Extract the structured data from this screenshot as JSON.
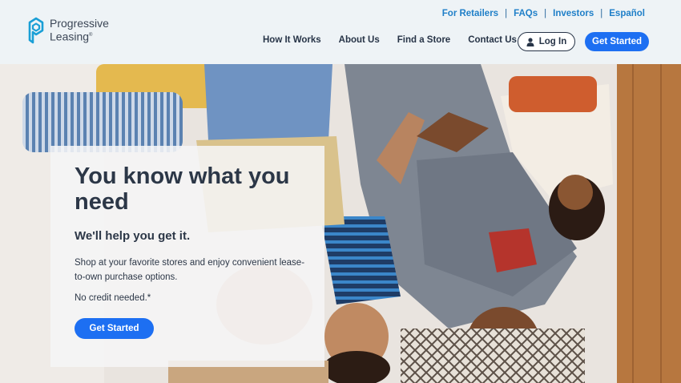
{
  "brand": {
    "name_line1": "Progressive",
    "name_line2": "Leasing",
    "trademark": "®"
  },
  "utility_nav": [
    "For Retailers",
    "FAQs",
    "Investors",
    "Español"
  ],
  "main_nav": [
    "How It Works",
    "About Us",
    "Find a Store",
    "Contact Us"
  ],
  "header": {
    "login_label": "Log In",
    "cta_label": "Get Started"
  },
  "hero": {
    "headline": "You know what you need",
    "subheadline": "We'll help you get it.",
    "description": "Shop at your favorite stores and enjoy convenient lease-to-own purchase options.",
    "note": "No credit needed.*",
    "cta_label": "Get Started",
    "photo_icon": "family-photo"
  },
  "colors": {
    "accent": "#1d6ff2",
    "link": "#1f7fc8",
    "text": "#2c3747",
    "header_bg": "#eef3f6"
  }
}
